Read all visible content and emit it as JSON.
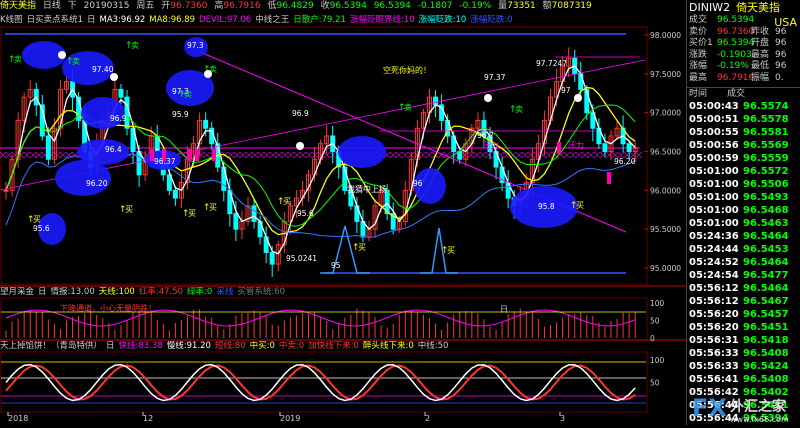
{
  "title_bar": {
    "symbol": "倚天美指",
    "period": "日线",
    "arrow": "下",
    "date": "20190315",
    "weekday": "周五",
    "open_label": "开",
    "open": "96.7360",
    "high_label": "高",
    "high": "96.7916",
    "low_label": "低",
    "low": "96.4829",
    "close_label": "收",
    "close": "96.5394",
    "last": "96.5394",
    "change": "-0.1807",
    "change_pct": "-0.19%",
    "volume_label": "量",
    "volume": "73351",
    "amount_label": "额",
    "amount": "7087319"
  },
  "ma_bar": {
    "items": [
      {
        "text": "K线图",
        "color": "#cccccc"
      },
      {
        "text": "日买卖点系统1",
        "color": "#cccccc"
      },
      {
        "text": "日",
        "color": "#cccccc"
      },
      {
        "text": "MA3:96.92",
        "color": "#ffffff"
      },
      {
        "text": "MA8:96.89",
        "color": "#ffff00"
      },
      {
        "text": "DEVIL:97.06",
        "color": "#ff00ff"
      },
      {
        "text": "中线之王",
        "color": "#cccccc"
      },
      {
        "text": "日散户:79.21",
        "color": "#00ff00"
      },
      {
        "text": "涨幅贬眼界线:10",
        "color": "#ff00ff"
      },
      {
        "text": "涨幅贬跌:10",
        "color": "#00ffff"
      },
      {
        "text": "涨幅贬跌:0",
        "color": "#3355ff"
      }
    ]
  },
  "ind1_bar": {
    "items": [
      {
        "text": "望月采金",
        "color": "#cccccc"
      },
      {
        "text": "日",
        "color": "#cccccc"
      },
      {
        "text": "情报:13.00",
        "color": "#cccccc"
      },
      {
        "text": "天线:100",
        "color": "#ffff00"
      },
      {
        "text": "红率:47.50",
        "color": "#ff3333"
      },
      {
        "text": "绿率:0",
        "color": "#00ff00"
      },
      {
        "text": "采线",
        "color": "#3355ff"
      },
      {
        "text": "买管系统:60",
        "color": "#777777"
      }
    ]
  },
  "ind2_bar": {
    "items": [
      {
        "text": "天上掉馅饼！（青岛特供）",
        "color": "#cccccc"
      },
      {
        "text": "日",
        "color": "#cccccc"
      },
      {
        "text": "快线:83.38",
        "color": "#ff00ff"
      },
      {
        "text": "慢线:91.20",
        "color": "#ffffff"
      },
      {
        "text": "短线:80",
        "color": "#ff3333"
      },
      {
        "text": "中买:0",
        "color": "#ffff00"
      },
      {
        "text": "中卖:0",
        "color": "#ff3333"
      },
      {
        "text": "加快线下来:0",
        "color": "#ff3333"
      },
      {
        "text": "醉头线下来:0",
        "color": "#ffff00"
      },
      {
        "text": "中线:50",
        "color": "#cccccc"
      }
    ]
  },
  "annotations": {
    "chart_labels": [
      {
        "text": "97.3",
        "color": "#ffffff"
      },
      {
        "text": "97.40",
        "color": "#ffffff"
      },
      {
        "text": "97.3",
        "color": "#ffffff"
      },
      {
        "text": "96.9",
        "color": "#ffffff"
      },
      {
        "text": "95.9",
        "color": "#ffffff"
      },
      {
        "text": "96.4",
        "color": "#ffffff"
      },
      {
        "text": "96.37",
        "color": "#ffffff"
      },
      {
        "text": "96.20",
        "color": "#ffffff"
      },
      {
        "text": "95.6",
        "color": "#ffffff"
      },
      {
        "text": "96.9",
        "color": "#ffffff"
      },
      {
        "text": "95.6",
        "color": "#ffffff"
      },
      {
        "text": "95.0241",
        "color": "#ffffff"
      },
      {
        "text": "95",
        "color": "#ffffff"
      },
      {
        "text": "96",
        "color": "#ffffff"
      },
      {
        "text": "97.37",
        "color": "#ffffff"
      },
      {
        "text": "96.2",
        "color": "#ffffff"
      },
      {
        "text": "97.7247",
        "color": "#ffffff"
      },
      {
        "text": "97",
        "color": "#ffffff"
      },
      {
        "text": "95.8",
        "color": "#ffffff"
      },
      {
        "text": "96.20",
        "color": "#ffffff"
      }
    ],
    "signals": [
      {
        "text": "卖",
        "color": "#00ff00"
      },
      {
        "text": "卖",
        "color": "#00ff00"
      },
      {
        "text": "卖",
        "color": "#00ff00"
      },
      {
        "text": "卖",
        "color": "#00ff00"
      },
      {
        "text": "卖",
        "color": "#00ff00"
      },
      {
        "text": "卖",
        "color": "#00ff00"
      },
      {
        "text": "卖",
        "color": "#00ff00"
      },
      {
        "text": "买",
        "color": "#ffff00"
      },
      {
        "text": "买",
        "color": "#ffff00"
      },
      {
        "text": "买",
        "color": "#ffff00"
      },
      {
        "text": "买",
        "color": "#ffff00"
      },
      {
        "text": "买",
        "color": "#ffff00"
      },
      {
        "text": "买",
        "color": "#ffff00"
      },
      {
        "text": "买",
        "color": "#ffff00"
      },
      {
        "text": "买",
        "color": "#ffff00"
      }
    ],
    "texts": [
      {
        "text": "空死你妈的！",
        "color": "#ffff00"
      },
      {
        "text": "我猜中上扬",
        "color": "#ffffff"
      },
      {
        "text": "压力",
        "color": "#ff00ff"
      },
      {
        "text": "压力",
        "color": "#ff00ff"
      },
      {
        "text": "下降通道，小心无量阴跌！",
        "color": "#ff3333"
      },
      {
        "text": "日",
        "color": "#cccccc"
      }
    ]
  },
  "y_axis_main": [
    "98.0000",
    "97.5000",
    "97.0000",
    "96.5000",
    "96.0000",
    "95.5000",
    "95.0000"
  ],
  "y_axis_ind1": [
    "100",
    "50",
    "0"
  ],
  "y_axis_ind2": [
    "100",
    "50"
  ],
  "x_axis": [
    "2018",
    "12",
    "2019",
    "2",
    "3"
  ],
  "side": {
    "code": "DINIW2",
    "name": "倚天美指",
    "market": "USA",
    "quote_rows": [
      {
        "l": "成交",
        "v": "96.5394",
        "vc": "#00ff00",
        "l2": "",
        "v2": ""
      },
      {
        "l": "卖价",
        "v": "96.7360",
        "vc": "#ff3333",
        "l2": "昨收",
        "v2": "96"
      },
      {
        "l": "买价1",
        "v": "96.5394",
        "vc": "#00ff00",
        "l2": "开盘",
        "v2": "96"
      },
      {
        "l": "涨跌",
        "v": "-0.1903",
        "vc": "#00ff00",
        "l2": "最高",
        "v2": "96"
      },
      {
        "l": "涨幅",
        "v": "-0.19%",
        "vc": "#00ff00",
        "l2": "最低",
        "v2": "96"
      },
      {
        "l": "最高",
        "v": "96.7916",
        "vc": "#ff3333",
        "l2": "振幅",
        "v2": "0."
      }
    ],
    "trade_header": {
      "time": "时间",
      "price": "成交"
    },
    "trades": [
      {
        "t": "05:00:43",
        "p": "96.5574"
      },
      {
        "t": "05:00:51",
        "p": "96.5578"
      },
      {
        "t": "05:00:55",
        "p": "96.5581"
      },
      {
        "t": "05:00:56",
        "p": "96.5569"
      },
      {
        "t": "05:00:59",
        "p": "96.5559"
      },
      {
        "t": "05:01:00",
        "p": "96.5572"
      },
      {
        "t": "05:01:00",
        "p": "96.5506"
      },
      {
        "t": "05:01:00",
        "p": "96.5493"
      },
      {
        "t": "05:01:00",
        "p": "96.5468"
      },
      {
        "t": "05:01:00",
        "p": "96.5463"
      },
      {
        "t": "05:24:36",
        "p": "96.5464"
      },
      {
        "t": "05:24:44",
        "p": "96.5453"
      },
      {
        "t": "05:24:52",
        "p": "96.5464"
      },
      {
        "t": "05:24:54",
        "p": "96.5477"
      },
      {
        "t": "05:56:12",
        "p": "96.5464"
      },
      {
        "t": "05:56:12",
        "p": "96.5467"
      },
      {
        "t": "05:56:20",
        "p": "96.5457"
      },
      {
        "t": "05:56:20",
        "p": "96.5451"
      },
      {
        "t": "05:56:31",
        "p": "96.5418"
      },
      {
        "t": "05:56:33",
        "p": "96.5408"
      },
      {
        "t": "05:56:33",
        "p": "96.5424"
      },
      {
        "t": "05:56:41",
        "p": "96.5408"
      },
      {
        "t": "05:56:42",
        "p": "96.5402"
      },
      {
        "t": "05:56:44",
        "p": "96.5411"
      },
      {
        "t": "05:56:44",
        "p": "96.5394"
      }
    ]
  },
  "watermark": {
    "brand_fx": "FX",
    "brand_cn": "外汇之家",
    "url": "www.fx68.com"
  },
  "colors": {
    "bull": "#ff3333",
    "bear": "#00ffff",
    "ma3": "#ffffff",
    "ma8": "#ffff00",
    "devil": "#ff00ff",
    "oval": "#1a1aff",
    "divider": "#cc0000"
  }
}
